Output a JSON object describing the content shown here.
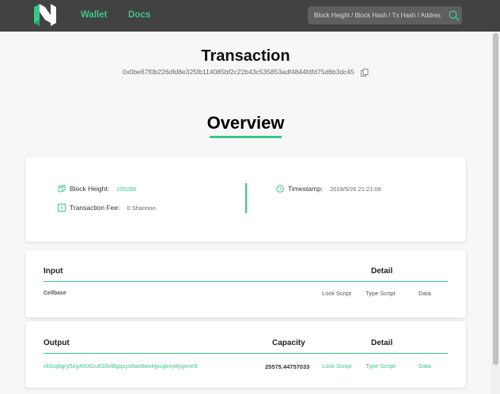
{
  "nav": {
    "wallet": "Wallet",
    "docs": "Docs",
    "search_placeholder": "Block Height / Block Hash / Tx Hash / Address"
  },
  "transaction": {
    "title": "Transaction",
    "hash": "0x0be67f0b226dfd8e325fb114085bf2c22b43c535853adf4844fdfd75d6b3dc45"
  },
  "overview": {
    "title": "Overview",
    "block_height_label": "Block Height:",
    "block_height": "105288",
    "fee_label": "Transaction Fee:",
    "fee": "0 Shannon",
    "timestamp_label": "Timestamp:",
    "timestamp": "2019/5/26 21:21:06"
  },
  "input": {
    "header": "Input",
    "detail_header": "Detail",
    "address": "Cellbase",
    "lock_script": "Lock Script",
    "type_script": "Type Script",
    "data": "Data"
  },
  "output": {
    "header": "Output",
    "capacity_header": "Capacity",
    "detail_header": "Detail",
    "address": "ckt1q9gry5zg4000zu633vl8gqzyv8as8wxejpcgexy8ygvne9",
    "capacity": "25575.44757033",
    "lock_script": "Lock Script",
    "type_script": "Type Script",
    "data": "Data"
  },
  "colors": {
    "accent": "#3cc68a",
    "topbar": "#424242"
  }
}
